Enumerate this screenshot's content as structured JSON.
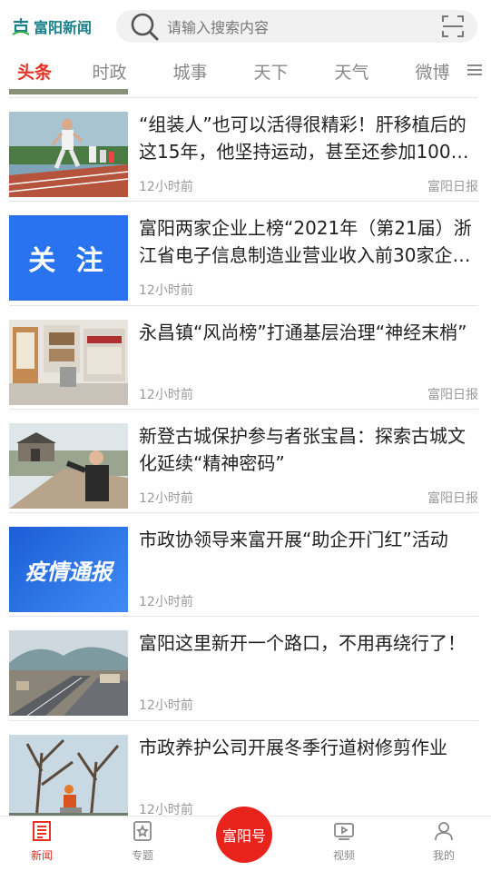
{
  "header": {
    "logo_text": "富阳新闻",
    "search_placeholder": "请输入搜索内容"
  },
  "tabs": [
    {
      "label": "头条",
      "active": true
    },
    {
      "label": "时政"
    },
    {
      "label": "城事"
    },
    {
      "label": "天下"
    },
    {
      "label": "天气"
    },
    {
      "label": "微博"
    }
  ],
  "articles": [
    {
      "title": "“组装人”也可以活得很精彩！肝移植后的这15年，他坚持运动，甚至还参加100…",
      "time": "12小时前",
      "source": "富阳日报",
      "thumb": "runners"
    },
    {
      "title": "富阳两家企业上榜“2021年（第21届）浙江省电子信息制造业营业收入前30家企…",
      "time": "12小时前",
      "source": "",
      "thumb": "focus",
      "thumb_text": "关 注"
    },
    {
      "title": "永昌镇“风尚榜”打通基层治理“神经末梢”",
      "time": "12小时前",
      "source": "富阳日报",
      "thumb": "exhibit"
    },
    {
      "title": "新登古城保护参与者张宝昌：探索古城文化延续“精神密码”",
      "time": "12小时前",
      "source": "富阳日报",
      "thumb": "oldtown"
    },
    {
      "title": "市政协领导来富开展“助企开门红”活动",
      "time": "12小时前",
      "source": "",
      "thumb": "epidemic",
      "thumb_text": "疫情通报"
    },
    {
      "title": "富阳这里新开一个路口，不用再绕行了！",
      "time": "12小时前",
      "source": "",
      "thumb": "road"
    },
    {
      "title": "市政养护公司开展冬季行道树修剪作业",
      "time": "12小时前",
      "source": "",
      "thumb": "trees"
    }
  ],
  "bottom_nav": {
    "news": "新闻",
    "topics": "专题",
    "center": "富阳号",
    "video": "视频",
    "mine": "我的"
  },
  "colors": {
    "accent": "#e53024",
    "logo": "#1b7f8a",
    "focus_blue": "#2a73f0"
  }
}
